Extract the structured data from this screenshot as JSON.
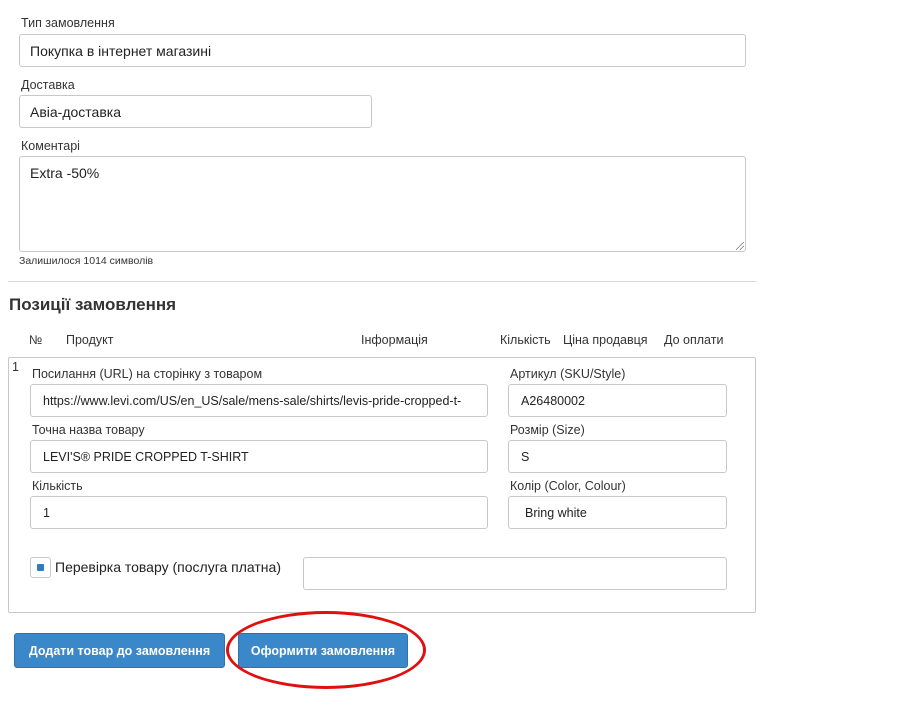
{
  "form": {
    "order_type": {
      "label": "Тип замовлення",
      "value": "Покупка в інтернет магазині"
    },
    "delivery": {
      "label": "Доставка",
      "value": "Авіа-доставка"
    },
    "comments": {
      "label": "Коментарі",
      "value": "Extra -50%",
      "remaining": "Залишилося 1014 символів"
    }
  },
  "positions": {
    "title": "Позиції замовлення",
    "columns": [
      "№",
      "Продукт",
      "Інформація",
      "Кількість",
      "Ціна продавця",
      "До оплати"
    ]
  },
  "item": {
    "number": "1",
    "url": {
      "label": "Посилання (URL) на сторінку з товаром",
      "value": "https://www.levi.com/US/en_US/sale/mens-sale/shirts/levis-pride-cropped-t-"
    },
    "sku": {
      "label": "Артикул (SKU/Style)",
      "value": "A26480002"
    },
    "name": {
      "label": "Точна назва товару",
      "value": "LEVI'S® PRIDE CROPPED T-SHIRT"
    },
    "size": {
      "label": "Розмір (Size)",
      "value": "S"
    },
    "quantity": {
      "label": "Кількість",
      "value": "1"
    },
    "color": {
      "label": "Колір (Color, Colour)",
      "value": "Bring white"
    },
    "inspection": {
      "label": "Перевірка товару (послуга платна)",
      "checked": true,
      "value": ""
    }
  },
  "buttons": {
    "add_item": "Додати товар до замовлення",
    "checkout": "Оформити замовлення"
  },
  "colors": {
    "button": "#3a87c9",
    "highlight": "#e01010"
  }
}
